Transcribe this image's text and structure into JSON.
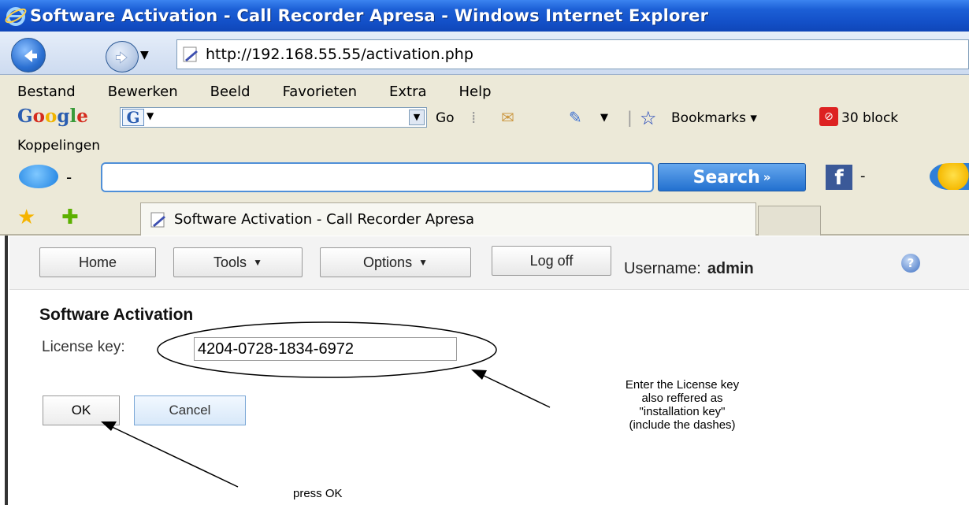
{
  "window": {
    "title": "Software Activation - Call Recorder Apresa - Windows Internet Explorer"
  },
  "address_bar": {
    "url": "http://192.168.55.55/activation.php"
  },
  "menu": {
    "items": [
      "Bestand",
      "Bewerken",
      "Beeld",
      "Favorieten",
      "Extra",
      "Help"
    ]
  },
  "google_toolbar": {
    "logo": "Google",
    "go_label": "Go",
    "bookmarks_label": "Bookmarks",
    "blocked_label": "30 block"
  },
  "links_bar": {
    "label": "Koppelingen"
  },
  "search_toolbar": {
    "search_button": "Search"
  },
  "tab": {
    "title": "Software Activation - Call Recorder Apresa"
  },
  "app_nav": {
    "home": "Home",
    "tools": "Tools",
    "options": "Options",
    "logoff": "Log off",
    "username_label": "Username:",
    "username_value": "admin"
  },
  "form": {
    "title": "Software Activation",
    "license_label": "License key:",
    "license_value": "4204-0728-1834-6972",
    "ok_label": "OK",
    "cancel_label": "Cancel"
  },
  "annotations": {
    "license_note": [
      "Enter the License key",
      "also reffered as",
      "\"installation key\"",
      "(include the dashes)"
    ],
    "ok_note": "press OK"
  }
}
